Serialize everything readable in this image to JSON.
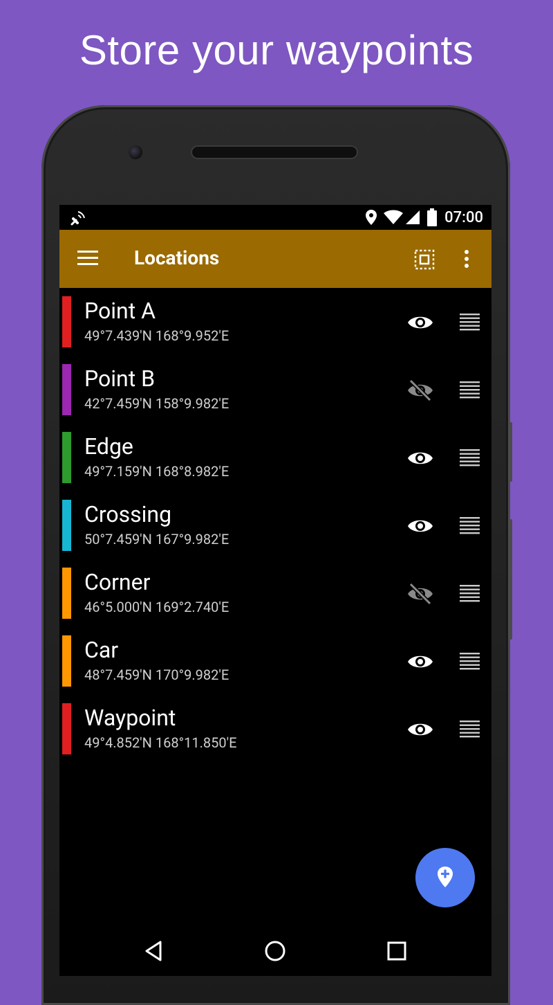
{
  "promo": {
    "headline": "Store your waypoints"
  },
  "status_bar": {
    "time": "07:00",
    "icons": [
      "gps-signal-icon",
      "location-pin-icon",
      "wifi-icon",
      "cell-signal-icon",
      "battery-icon"
    ]
  },
  "app_bar": {
    "title": "Locations",
    "background": "#9b6a00",
    "actions": [
      "menu-icon",
      "select-all-icon",
      "more-vert-icon"
    ]
  },
  "locations": [
    {
      "name": "Point A",
      "coords": "49°7.439'N 168°9.952'E",
      "color": "#e02020",
      "visible": true
    },
    {
      "name": "Point B",
      "coords": "42°7.459'N 158°9.982'E",
      "color": "#9c27b0",
      "visible": false
    },
    {
      "name": "Edge",
      "coords": "49°7.159'N 168°8.982'E",
      "color": "#2e9b2e",
      "visible": true
    },
    {
      "name": "Crossing",
      "coords": "50°7.459'N 167°9.982'E",
      "color": "#17b7d3",
      "visible": true
    },
    {
      "name": "Corner",
      "coords": "46°5.000'N 169°2.740'E",
      "color": "#ff9800",
      "visible": false
    },
    {
      "name": "Car",
      "coords": "48°7.459'N 170°9.982'E",
      "color": "#ff9800",
      "visible": true
    },
    {
      "name": "Waypoint",
      "coords": "49°4.852'N 168°11.850'E",
      "color": "#e02020",
      "visible": true
    }
  ],
  "fab": {
    "icon": "add-location-icon",
    "color": "#4f79f0"
  },
  "nav_bar": {
    "icons": [
      "back-icon",
      "home-icon",
      "recents-icon"
    ]
  }
}
